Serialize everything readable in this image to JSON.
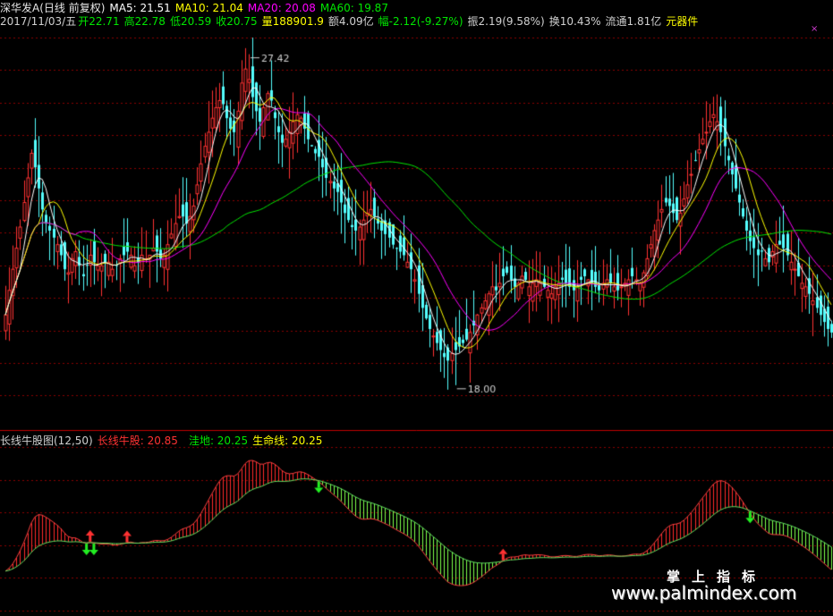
{
  "header": {
    "stock_name": "深华发A(日线 前复权)",
    "ma5": "MA5: 21.51",
    "ma10": "MA10: 21.04",
    "ma20": "MA20: 20.08",
    "ma60": "MA60: 19.87",
    "date": "2017/11/03/五",
    "open": "开22.71",
    "high": "高22.78",
    "low": "低20.59",
    "close": "收20.75",
    "volume": "量188901.9",
    "amount": "额4.09亿",
    "change": "幅-2.12(-9.27%)",
    "amplitude": "振2.19(9.58%)",
    "turnover": "换10.43%",
    "float_value": "流通1.81亿",
    "sector": "元器件"
  },
  "indicator": {
    "name": "长线牛股图(12,50)",
    "bull_line": "长线牛股: 20.85",
    "depression": "洼地: 20.25",
    "lifeline": "生命线: 20.25"
  },
  "close_glyph": "×",
  "watermark": {
    "cn": "掌上指标",
    "url": "www.palmindex.com"
  },
  "colors": {
    "up": "#ff3232",
    "down": "#54ffff",
    "ma5": "#ffffff",
    "ma10": "#ffff00",
    "ma20": "#ff00ff",
    "ma60": "#00e600",
    "grid": "#8b0000",
    "bull": "#ff2a2a",
    "bear": "#7dff4a"
  },
  "chart_data": [
    {
      "type": "candlestick",
      "title": "深华发A(日线 前复权)",
      "price_range": [
        16.8,
        28.2
      ],
      "annotations": [
        {
          "text": "27.42",
          "price": 27.42,
          "bar": 66
        },
        {
          "text": "18.00",
          "price": 18.0,
          "bar": 122
        }
      ],
      "close": [
        20.0,
        20.7,
        21.3,
        21.9,
        22.5,
        23.2,
        23.9,
        24.6,
        24.2,
        23.6,
        23.0,
        22.6,
        22.4,
        22.2,
        22.0,
        21.7,
        21.3,
        21.2,
        21.6,
        21.8,
        21.4,
        21.1,
        21.4,
        21.7,
        21.5,
        21.4,
        21.4,
        21.5,
        21.5,
        21.3,
        21.4,
        21.6,
        21.7,
        21.8,
        21.7,
        21.4,
        21.5,
        21.7,
        21.6,
        21.7,
        21.9,
        21.8,
        21.6,
        21.7,
        22.0,
        22.3,
        22.6,
        22.8,
        22.8,
        22.6,
        22.8,
        23.1,
        23.7,
        24.3,
        24.8,
        25.2,
        25.6,
        25.9,
        26.1,
        26.0,
        25.6,
        25.3,
        25.2,
        25.8,
        26.6,
        27.0,
        26.7,
        26.2,
        25.8,
        25.5,
        25.9,
        26.3,
        26.1,
        25.6,
        25.2,
        24.9,
        25.0,
        25.2,
        25.5,
        25.7,
        25.6,
        25.3,
        25.0,
        24.8,
        24.6,
        24.5,
        24.2,
        23.9,
        23.8,
        23.6,
        23.5,
        23.2,
        22.9,
        22.7,
        22.5,
        22.4,
        22.5,
        22.7,
        22.9,
        23.0,
        22.8,
        22.6,
        22.4,
        22.3,
        22.2,
        22.0,
        21.9,
        21.8,
        21.7,
        21.5,
        21.3,
        21.0,
        20.6,
        20.2,
        19.9,
        19.6,
        19.4,
        19.2,
        19.0,
        18.8,
        18.7,
        18.9,
        19.0,
        19.1,
        19.2,
        19.3,
        19.5,
        19.7,
        20.0,
        20.2,
        20.4,
        20.6,
        20.8,
        20.7,
        20.9,
        21.1,
        21.2,
        21.0,
        20.8,
        20.9,
        21.1,
        21.0,
        20.8,
        20.9,
        21.0,
        20.9,
        20.8,
        20.7,
        20.6,
        20.8,
        20.9,
        21.0,
        20.9,
        20.8,
        20.7,
        20.8,
        21.0,
        21.1,
        21.0,
        20.9,
        20.8,
        20.7,
        20.9,
        21.0,
        20.9,
        20.8,
        20.7,
        20.8,
        20.9,
        21.0,
        21.1,
        21.0,
        20.9,
        21.2,
        21.6,
        22.0,
        22.4,
        22.7,
        23.0,
        23.2,
        23.1,
        22.9,
        22.7,
        22.9,
        23.3,
        23.7,
        24.0,
        24.4,
        24.7,
        25.0,
        25.2,
        25.5,
        25.7,
        25.5,
        25.2,
        24.8,
        24.4,
        24.0,
        23.6,
        23.2,
        22.8,
        22.4,
        22.1,
        21.9,
        21.7,
        21.8,
        21.6,
        21.5,
        21.8,
        22.0,
        22.0,
        21.9,
        21.7,
        21.5,
        21.3,
        21.1,
        20.9,
        20.8,
        20.6,
        20.4,
        20.2,
        20.0,
        19.8,
        19.6,
        19.5
      ]
    },
    {
      "type": "area",
      "title": "长线牛股图(12,50)",
      "series": [
        {
          "name": "长线牛股",
          "value": 20.85
        },
        {
          "name": "洼地",
          "value": 20.25
        },
        {
          "name": "生命线",
          "value": 20.25
        }
      ]
    }
  ]
}
